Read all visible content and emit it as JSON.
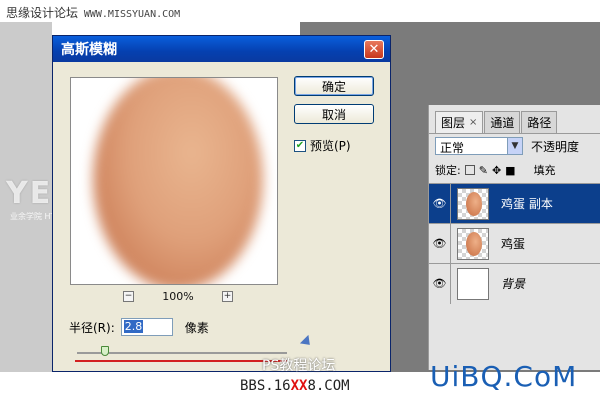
{
  "site": {
    "title": "思缘设计论坛",
    "url": "WWW.MISSYUAN.COM"
  },
  "watermark_left": {
    "big": "YEU.PS",
    "sub": "业余学院  HTTP://WWW.YYXY.NET"
  },
  "dialog": {
    "title": "高斯模糊",
    "close_glyph": "✕",
    "ok_label": "确定",
    "cancel_label": "取消",
    "preview_label": "预览(P)",
    "preview_checked": true,
    "zoom": {
      "minus": "−",
      "value": "100%",
      "plus": "+"
    },
    "radius_label": "半径(R):",
    "radius_value": "2.8",
    "unit": "像素"
  },
  "layers_panel": {
    "tabs": [
      {
        "label": "图层",
        "close": "×"
      },
      {
        "label": "通道"
      },
      {
        "label": "路径"
      }
    ],
    "blend_mode": "正常",
    "opacity_label": "不透明度",
    "lock_label": "锁定:",
    "fill_label": "填充",
    "layers": [
      {
        "name": "鸡蛋 副本",
        "selected": true,
        "visible": true
      },
      {
        "name": "鸡蛋",
        "selected": false,
        "visible": true
      },
      {
        "name": "背景",
        "selected": false,
        "visible": true
      }
    ]
  },
  "bottom": {
    "ps_forum": "PS教程论坛",
    "bbs_prefix": "BBS.16",
    "bbs_red": "XX",
    "bbs_suffix": "8.COM",
    "uibq": "UiBQ.CoM"
  },
  "colors": {
    "selection": "#0c3f8c",
    "red_mark": "#d32020",
    "titlebar": "#0a5fdc"
  }
}
